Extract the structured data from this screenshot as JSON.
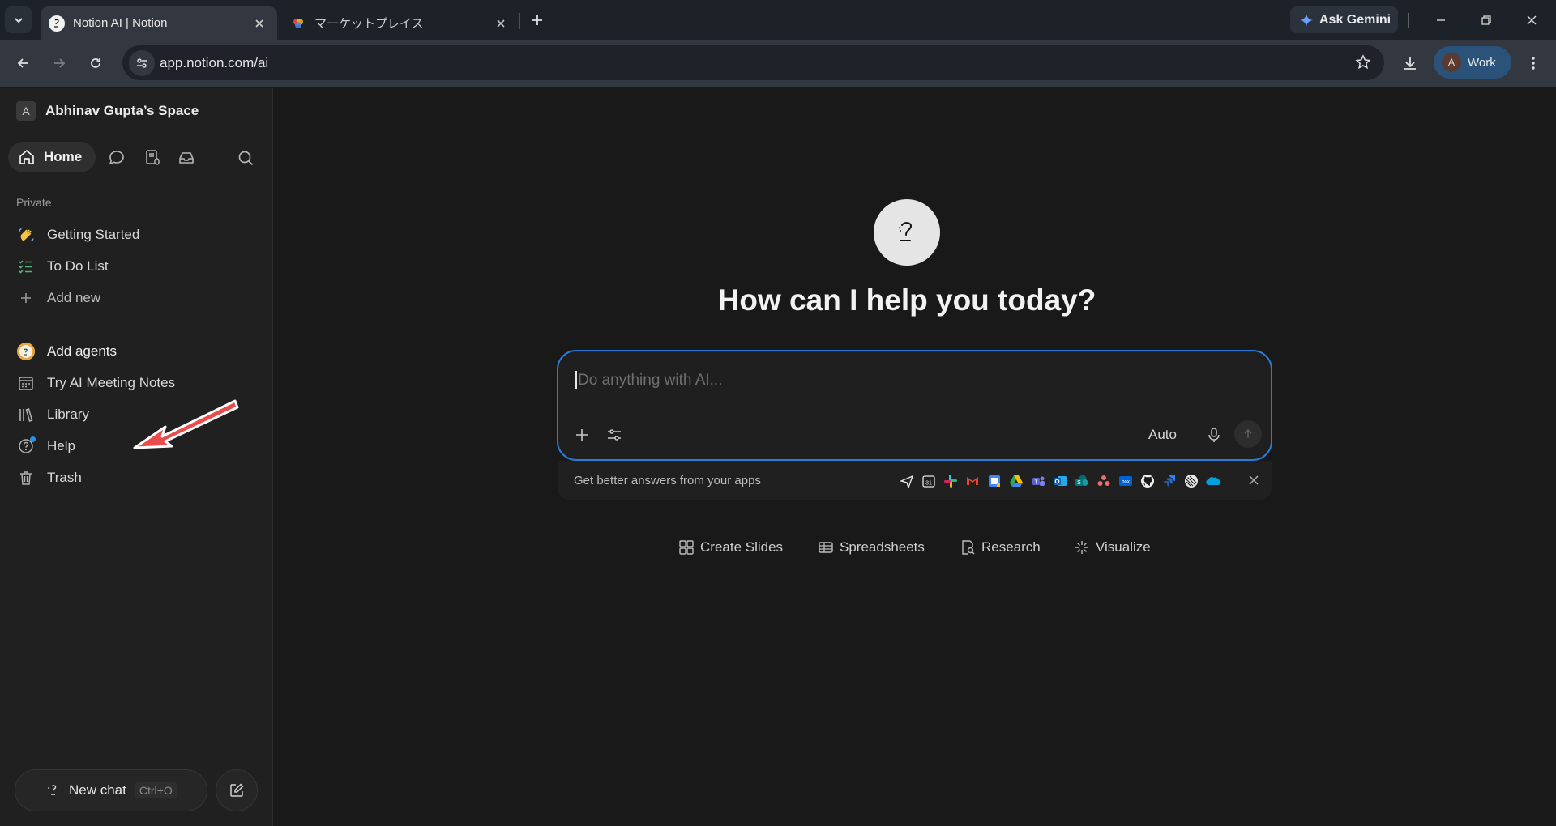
{
  "browser": {
    "tabs": [
      {
        "title": "Notion AI | Notion",
        "active": true,
        "favicon": "notion-ai-icon"
      },
      {
        "title": "マーケットプレイス",
        "active": false,
        "favicon": "marketplace-icon"
      }
    ],
    "ask_gemini": "Ask Gemini",
    "url": "app.notion.com/ai",
    "profile": {
      "initial": "A",
      "label": "Work"
    }
  },
  "sidebar": {
    "workspace": {
      "initial": "A",
      "name": "Abhinav Gupta’s Space"
    },
    "home_label": "Home",
    "section_private": "Private",
    "private_items": [
      {
        "label": "Getting Started",
        "icon": "wave-emoji-icon"
      },
      {
        "label": "To Do List",
        "icon": "checklist-icon"
      },
      {
        "label": "Add new",
        "icon": "plus-icon"
      }
    ],
    "items": [
      {
        "label": "Add agents",
        "icon": "agent-face-icon"
      },
      {
        "label": "Try AI Meeting Notes",
        "icon": "calendar-icon"
      },
      {
        "label": "Library",
        "icon": "library-icon"
      },
      {
        "label": "Help",
        "icon": "help-icon"
      },
      {
        "label": "Trash",
        "icon": "trash-icon"
      }
    ],
    "new_chat": {
      "label": "New chat",
      "shortcut": "Ctrl+O"
    }
  },
  "main": {
    "headline": "How can I help you today?",
    "input_placeholder": "Do anything with AI...",
    "model": "Auto",
    "apps_prompt": "Get better answers from your apps",
    "suggestions": [
      {
        "label": "Create Slides",
        "icon": "slides-grid-icon"
      },
      {
        "label": "Spreadsheets",
        "icon": "table-icon"
      },
      {
        "label": "Research",
        "icon": "research-icon"
      },
      {
        "label": "Visualize",
        "icon": "sparkle-icon"
      }
    ]
  },
  "colors": {
    "accent": "#2a7ad8",
    "background": "#191919",
    "sidebar": "#202020"
  }
}
